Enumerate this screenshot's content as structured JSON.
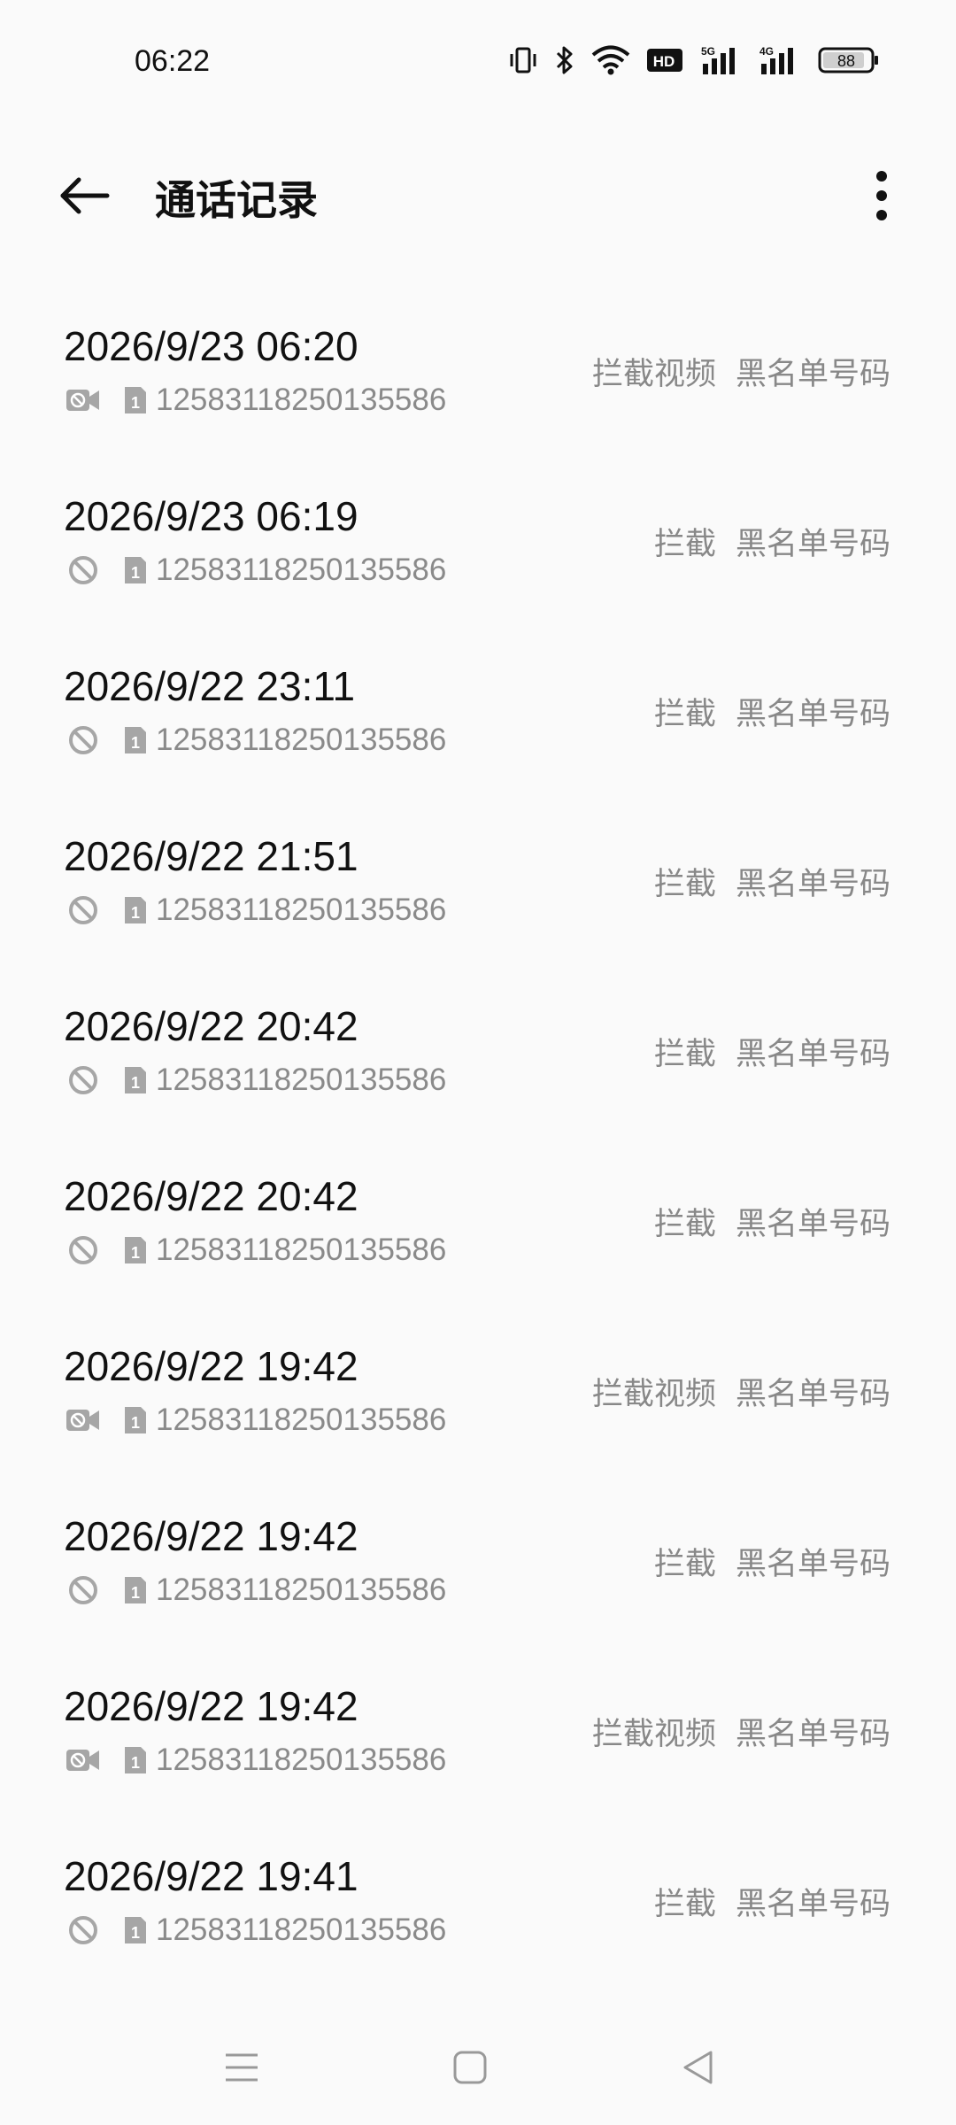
{
  "status_bar": {
    "time": "06:22",
    "icons": [
      "vibrate-icon",
      "bluetooth-icon",
      "wifi-icon",
      "hd-icon",
      "signal-5g-icon",
      "signal-4g-icon",
      "battery-icon"
    ],
    "hd_label": "HD",
    "net1": "5G",
    "net2": "4G",
    "battery": "88"
  },
  "header": {
    "title": "通话记录",
    "back_icon": "back-arrow-icon",
    "more_icon": "more-vert-icon"
  },
  "calls": [
    {
      "time": "2026/9/23 06:20",
      "type": "video",
      "number": "12583118250135586",
      "tag1": "拦截视频",
      "tag2": "黑名单号码"
    },
    {
      "time": "2026/9/23 06:19",
      "type": "blocked",
      "number": "12583118250135586",
      "tag1": "拦截",
      "tag2": "黑名单号码"
    },
    {
      "time": "2026/9/22 23:11",
      "type": "blocked",
      "number": "12583118250135586",
      "tag1": "拦截",
      "tag2": "黑名单号码"
    },
    {
      "time": "2026/9/22 21:51",
      "type": "blocked",
      "number": "12583118250135586",
      "tag1": "拦截",
      "tag2": "黑名单号码"
    },
    {
      "time": "2026/9/22 20:42",
      "type": "blocked",
      "number": "12583118250135586",
      "tag1": "拦截",
      "tag2": "黑名单号码"
    },
    {
      "time": "2026/9/22 20:42",
      "type": "blocked",
      "number": "12583118250135586",
      "tag1": "拦截",
      "tag2": "黑名单号码"
    },
    {
      "time": "2026/9/22 19:42",
      "type": "video",
      "number": "12583118250135586",
      "tag1": "拦截视频",
      "tag2": "黑名单号码"
    },
    {
      "time": "2026/9/22 19:42",
      "type": "blocked",
      "number": "12583118250135586",
      "tag1": "拦截",
      "tag2": "黑名单号码"
    },
    {
      "time": "2026/9/22 19:42",
      "type": "video",
      "number": "12583118250135586",
      "tag1": "拦截视频",
      "tag2": "黑名单号码"
    },
    {
      "time": "2026/9/22 19:41",
      "type": "blocked",
      "number": "12583118250135586",
      "tag1": "拦截",
      "tag2": "黑名单号码"
    }
  ],
  "sim_label": "1",
  "nav_bar": {
    "icons": [
      "menu-icon",
      "home-icon",
      "back-triangle-icon"
    ]
  },
  "colors": {
    "background": "#fafafa",
    "primary_text": "#111111",
    "secondary_text": "#888888",
    "icon_gray": "#a6a6a6"
  }
}
